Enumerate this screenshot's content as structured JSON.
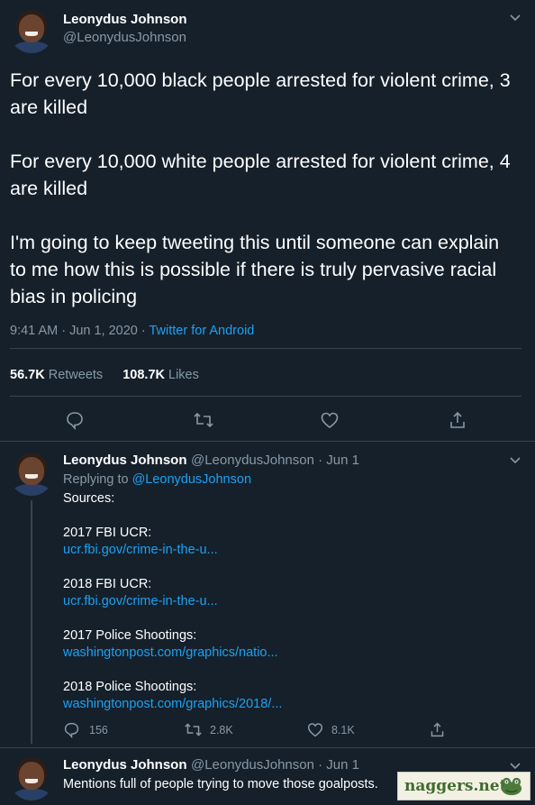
{
  "main_tweet": {
    "name": "Leonydus Johnson",
    "handle": "@LeonydusJohnson",
    "paragraphs": [
      "For every 10,000 black people arrested for violent crime, 3 are killed",
      "For every 10,000 white people arrested for violent crime, 4 are killed",
      "I'm going to keep tweeting this until someone can explain to me how this is possible if there is truly pervasive racial bias in policing"
    ],
    "time": "9:41 AM · Jun 1, 2020 · ",
    "source": "Twitter for Android",
    "retweets_count": "56.7K",
    "retweets_label": "Retweets",
    "likes_count": "108.7K",
    "likes_label": "Likes"
  },
  "reply_1": {
    "name": "Leonydus Johnson",
    "handle_date": "@LeonydusJohnson · Jun 1",
    "replying_prefix": "Replying to ",
    "replying_handle": "@LeonydusJohnson",
    "sources_title": "Sources:",
    "sources": [
      {
        "label": "2017 FBI UCR:",
        "url": "ucr.fbi.gov/crime-in-the-u..."
      },
      {
        "label": "2018 FBI UCR:",
        "url": "ucr.fbi.gov/crime-in-the-u..."
      },
      {
        "label": "2017 Police Shootings:",
        "url": "washingtonpost.com/graphics/natio..."
      },
      {
        "label": "2018 Police Shootings:",
        "url": "washingtonpost.com/graphics/2018/..."
      }
    ],
    "replies": "156",
    "retweets": "2.8K",
    "likes": "8.1K"
  },
  "reply_2": {
    "name": "Leonydus Johnson",
    "handle_date": "@LeonydusJohnson · Jun 1",
    "text": "Mentions full of people trying to move those goalposts."
  },
  "watermark": {
    "text": "naggers.net"
  },
  "icons": {
    "reply": "reply-icon",
    "retweet": "retweet-icon",
    "like": "heart-icon",
    "share": "share-icon",
    "menu": "chevron-down-icon"
  },
  "colors": {
    "background": "#15202b",
    "text": "#ffffff",
    "muted": "#8899a6",
    "link": "#1da1f2",
    "divider": "#38444d"
  }
}
